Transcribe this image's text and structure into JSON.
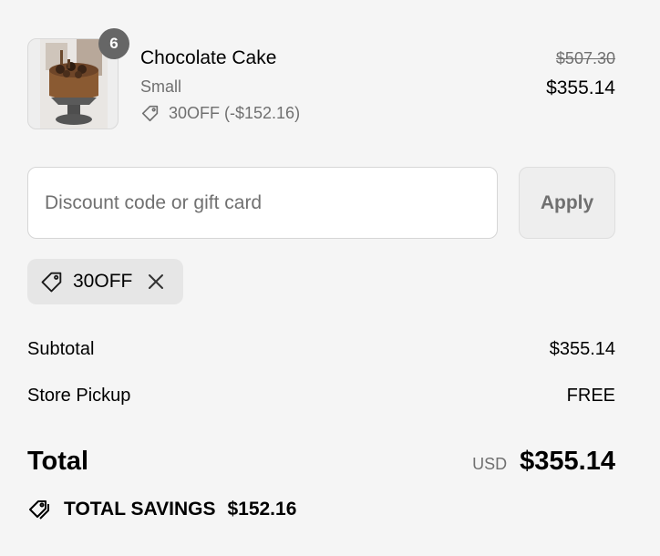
{
  "line_item": {
    "quantity": "6",
    "title": "Chocolate Cake",
    "variant": "Small",
    "discount_text": "30OFF (-$152.16)",
    "original_price": "$507.30",
    "final_price": "$355.14",
    "image_icon": "cake-photo"
  },
  "discount": {
    "placeholder": "Discount code or gift card",
    "apply_label": "Apply",
    "applied_code": "30OFF"
  },
  "summary": {
    "subtotal_label": "Subtotal",
    "subtotal_value": "$355.14",
    "shipping_label": "Store Pickup",
    "shipping_value": "FREE",
    "total_label": "Total",
    "currency": "USD",
    "total_value": "$355.14",
    "savings_label": "TOTAL SAVINGS",
    "savings_value": "$152.16"
  },
  "colors": {
    "background": "#f5f5f5",
    "muted_text": "#707070",
    "badge": "#666666"
  }
}
